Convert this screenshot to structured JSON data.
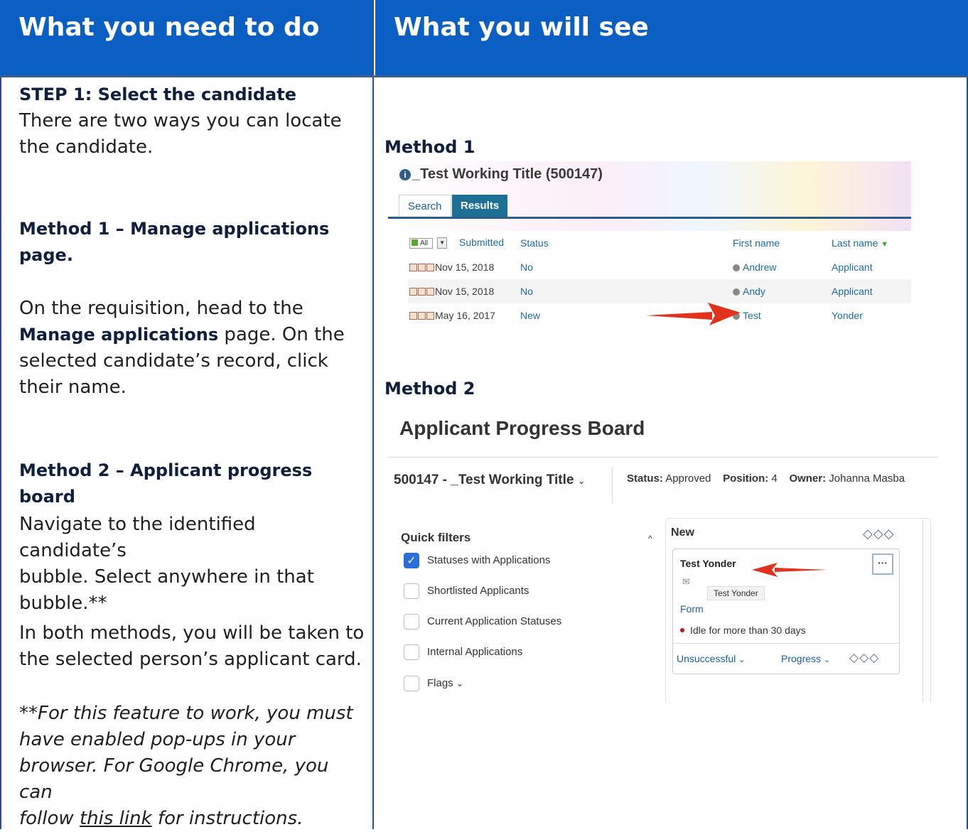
{
  "header": {
    "left": "What you need to do",
    "right": "What you will see"
  },
  "left": {
    "step_title": "STEP 1: Select the candidate",
    "step_text_l1": "There are two ways you can locate",
    "step_text_l2": "the candidate.",
    "m1_title_l1": "Method 1 – Manage applications",
    "m1_title_l2": "page.",
    "m1_l1": "On the requisition, head to the",
    "m1_bold": "Manage applications",
    "m1_l2_rest": " page. On the",
    "m1_l3": "selected candidate’s record, click",
    "m1_l4": "their name.",
    "m2_title_l1": "Method 2 – Applicant progress",
    "m2_title_l2": "board",
    "m2_l1": "Navigate to the identified candidate’s",
    "m2_l2": "bubble. Select anywhere in that",
    "m2_l3": "bubble.**",
    "both_l1": "In both methods, you will be taken to",
    "both_l2": "the selected person’s applicant card.",
    "note_l1": "**For this feature to work, you must",
    "note_l2": "have enabled pop-ups in your",
    "note_l3": "browser. For Google Chrome, you can",
    "note_l4_pre": "follow ",
    "note_link": "this link",
    "note_l4_post": " for instructions."
  },
  "right": {
    "method1_label": "Method 1",
    "method2_label": "Method 2",
    "s1": {
      "title": "_Test Working Title (500147)",
      "tab_search": "Search",
      "tab_results": "Results",
      "all": "All",
      "col_submitted": "Submitted",
      "col_status": "Status",
      "col_first": "First name",
      "col_last": "Last name",
      "rows": [
        {
          "date": "Nov 15, 2018",
          "status": "No",
          "first": "Andrew",
          "last": "Applicant"
        },
        {
          "date": "Nov 15, 2018",
          "status": "No",
          "first": "Andy",
          "last": "Applicant"
        },
        {
          "date": "May 16, 2017",
          "status": "New",
          "first": "Test",
          "last": "Yonder"
        }
      ]
    },
    "s2": {
      "page_title": "Applicant Progress Board",
      "requisition": "500147 - _Test Working Title",
      "status_label": "Status:",
      "status_value": "Approved",
      "position_label": "Position:",
      "position_value": "4",
      "owner_label": "Owner:",
      "owner_value": "Johanna Masba",
      "quick_filters": "Quick filters",
      "filters": [
        "Statuses with Applications",
        "Shortlisted Applicants",
        "Current Application Statuses",
        "Internal Applications",
        "Flags"
      ],
      "column_title": "New",
      "card_name": "Test Yonder",
      "tooltip": "Test Yonder",
      "form": "Form",
      "idle": "Idle for more than 30 days",
      "unsuccessful": "Unsuccessful",
      "progress": "Progress"
    }
  },
  "colors": {
    "header_bg": "#0b5fc2",
    "arrow": "#e0321c"
  }
}
